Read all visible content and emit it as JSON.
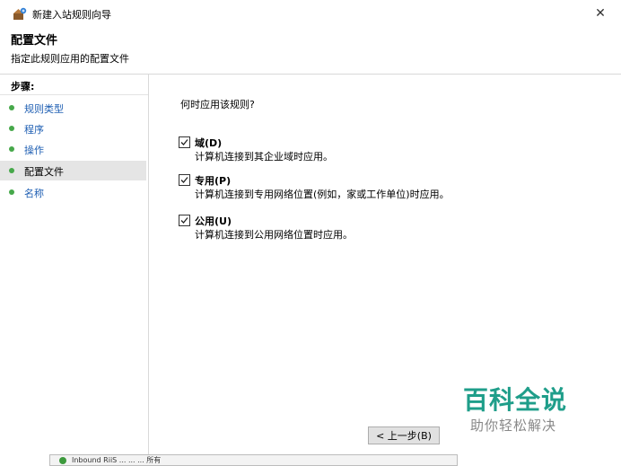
{
  "window": {
    "title": "新建入站规则向导",
    "close_glyph": "✕",
    "header_title": "配置文件",
    "header_subtitle": "指定此规则应用的配置文件"
  },
  "steps": {
    "heading": "步骤:",
    "items": [
      {
        "label": "规则类型",
        "active": false
      },
      {
        "label": "程序",
        "active": false
      },
      {
        "label": "操作",
        "active": false
      },
      {
        "label": "配置文件",
        "active": true
      },
      {
        "label": "名称",
        "active": false
      }
    ]
  },
  "main": {
    "question": "何时应用该规则?",
    "options": [
      {
        "title": "域(D)",
        "desc": "计算机连接到其企业域时应用。",
        "checked": true
      },
      {
        "title": "专用(P)",
        "desc": "计算机连接到专用网络位置(例如，家或工作单位)时应用。",
        "checked": true
      },
      {
        "title": "公用(U)",
        "desc": "计算机连接到公用网络位置时应用。",
        "checked": true
      }
    ],
    "back_button": "< 上一步(B)"
  },
  "watermark": {
    "line1": "百科全说",
    "line2": "助你轻松解决"
  },
  "background_window": {
    "text": "Inbound RiiS ... ... ... 所有"
  },
  "colors": {
    "step_link": "#1f5fb3",
    "step_dot": "#46a84a",
    "watermark_primary": "#1f9e8a"
  }
}
